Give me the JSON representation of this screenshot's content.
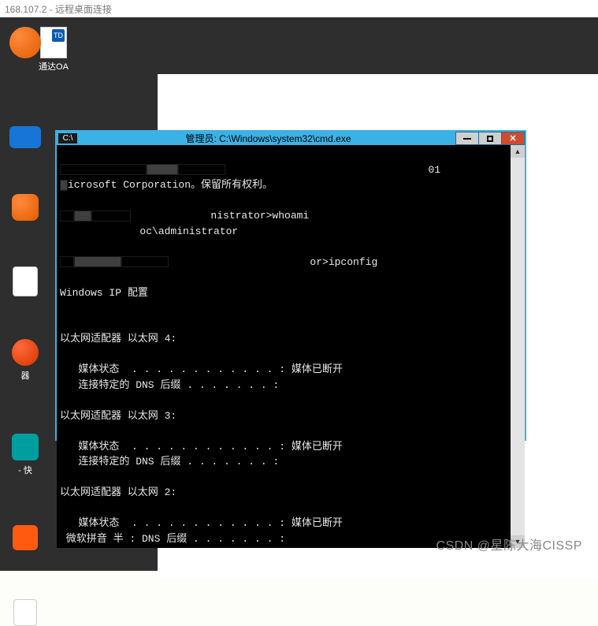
{
  "rdp": {
    "title": "168.107.2 - 远程桌面连接"
  },
  "desktop_icons": {
    "tongda": {
      "badge": "TD",
      "label": "通达OA"
    },
    "left_labels": {
      "qi": "器",
      "kuai": "- 快"
    }
  },
  "cmd": {
    "title": "管理员: C:\\Windows\\system32\\cmd.exe",
    "lines": {
      "l0a": "                                 01",
      "l0b": "icrosoft Corporation。保留所有权利。",
      "l1": "             nistrator>whoami",
      "l2": "             oc\\administrator",
      "l3": "                       or>ipconfig",
      "l4": "Windows IP 配置",
      "a4_hdr": "以太网适配器 以太网 4:",
      "a4_ms": "   媒体状态  . . . . . . . . . . . . : 媒体已断开",
      "a4_dns": "   连接特定的 DNS 后缀 . . . . . . . :",
      "a3_hdr": "以太网适配器 以太网 3:",
      "a3_ms": "   媒体状态  . . . . . . . . . . . . : 媒体已断开",
      "a3_dns": "   连接特定的 DNS 后缀 . . . . . . . :",
      "a2_hdr": "以太网适配器 以太网 2:",
      "a2_ms": "   媒体状态  . . . . . . . . . . . . : 媒体已断开",
      "a2_ime": " 微软拼音 半 : DNS 后缀 . . . . . . . :"
    }
  },
  "watermark": "CSDN @星陈大海CISSP"
}
